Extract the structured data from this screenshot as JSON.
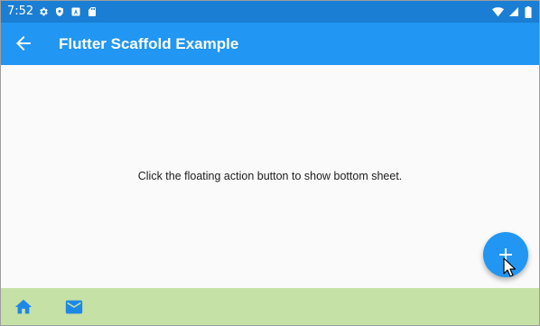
{
  "status_bar": {
    "time": "7:52",
    "left_icons": [
      "gear-icon",
      "shield-icon",
      "badge-icon",
      "sd-card-icon"
    ],
    "right_icons": [
      "wifi-icon",
      "signal-icon",
      "battery-icon"
    ],
    "background": "#1a7fd4"
  },
  "app_bar": {
    "title": "Flutter Scaffold Example",
    "back_icon": "arrow-back-icon",
    "background": "#2196f3"
  },
  "body": {
    "message": "Click the floating action button to show bottom sheet."
  },
  "fab": {
    "icon": "add-icon",
    "background": "#2196f3"
  },
  "bottom_bar": {
    "background": "#c5e1a5",
    "items": [
      {
        "icon": "home-icon"
      },
      {
        "icon": "mail-icon"
      }
    ]
  }
}
